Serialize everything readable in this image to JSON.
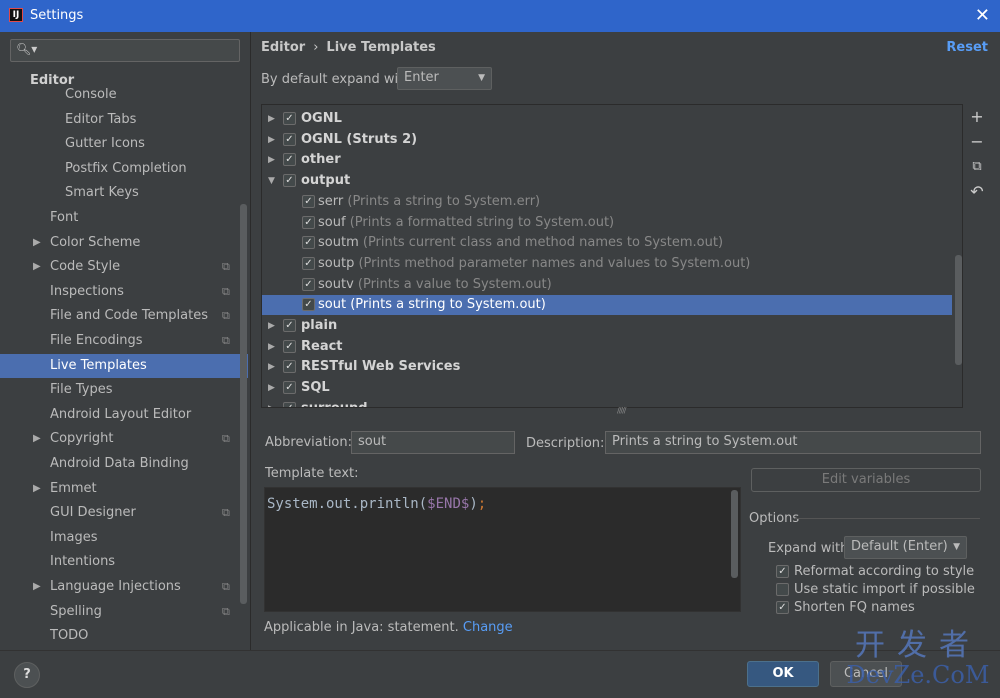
{
  "window": {
    "title": "Settings",
    "app_icon": "intellij-icon"
  },
  "sidebar": {
    "search_placeholder": "",
    "section": "Editor",
    "items": [
      {
        "label": "Console",
        "indent": 2
      },
      {
        "label": "Editor Tabs",
        "indent": 2
      },
      {
        "label": "Gutter Icons",
        "indent": 2
      },
      {
        "label": "Postfix Completion",
        "indent": 2
      },
      {
        "label": "Smart Keys",
        "indent": 2
      },
      {
        "label": "Font",
        "indent": 1
      },
      {
        "label": "Color Scheme",
        "indent": 1,
        "expandable": true
      },
      {
        "label": "Code Style",
        "indent": 1,
        "expandable": true,
        "project": true
      },
      {
        "label": "Inspections",
        "indent": 1,
        "project": true
      },
      {
        "label": "File and Code Templates",
        "indent": 1,
        "project": true
      },
      {
        "label": "File Encodings",
        "indent": 1,
        "project": true
      },
      {
        "label": "Live Templates",
        "indent": 1,
        "selected": true
      },
      {
        "label": "File Types",
        "indent": 1
      },
      {
        "label": "Android Layout Editor",
        "indent": 1
      },
      {
        "label": "Copyright",
        "indent": 1,
        "expandable": true,
        "project": true
      },
      {
        "label": "Android Data Binding",
        "indent": 1
      },
      {
        "label": "Emmet",
        "indent": 1,
        "expandable": true
      },
      {
        "label": "GUI Designer",
        "indent": 1,
        "project": true
      },
      {
        "label": "Images",
        "indent": 1
      },
      {
        "label": "Intentions",
        "indent": 1
      },
      {
        "label": "Language Injections",
        "indent": 1,
        "expandable": true,
        "project": true
      },
      {
        "label": "Spelling",
        "indent": 1,
        "project": true
      },
      {
        "label": "TODO",
        "indent": 1
      }
    ]
  },
  "header": {
    "crumb1": "Editor",
    "separator": "›",
    "crumb2": "Live Templates",
    "reset": "Reset"
  },
  "expand": {
    "label": "By default expand with",
    "value": "Enter"
  },
  "templates": [
    {
      "type": "group",
      "expanded": false,
      "checked": true,
      "name": "OGNL",
      "desc": ""
    },
    {
      "type": "group",
      "expanded": false,
      "checked": true,
      "name": "OGNL (Struts 2)",
      "desc": ""
    },
    {
      "type": "group",
      "expanded": false,
      "checked": true,
      "name": "other",
      "desc": ""
    },
    {
      "type": "group",
      "expanded": true,
      "checked": true,
      "name": "output",
      "desc": ""
    },
    {
      "type": "item",
      "checked": true,
      "name": "serr",
      "desc": "(Prints a string to System.err)"
    },
    {
      "type": "item",
      "checked": true,
      "name": "souf",
      "desc": "(Prints a formatted string to System.out)"
    },
    {
      "type": "item",
      "checked": true,
      "name": "soutm",
      "desc": "(Prints current class and method names to System.out)"
    },
    {
      "type": "item",
      "checked": true,
      "name": "soutp",
      "desc": "(Prints method parameter names and values to System.out)"
    },
    {
      "type": "item",
      "checked": true,
      "name": "soutv",
      "desc": "(Prints a value to System.out)"
    },
    {
      "type": "item",
      "checked": true,
      "name": "sout",
      "desc": "(Prints a string to System.out)",
      "selected": true
    },
    {
      "type": "group",
      "expanded": false,
      "checked": true,
      "name": "plain",
      "desc": ""
    },
    {
      "type": "group",
      "expanded": false,
      "checked": true,
      "name": "React",
      "desc": ""
    },
    {
      "type": "group",
      "expanded": false,
      "checked": true,
      "name": "RESTful Web Services",
      "desc": ""
    },
    {
      "type": "group",
      "expanded": false,
      "checked": true,
      "name": "SQL",
      "desc": ""
    },
    {
      "type": "group",
      "expanded": false,
      "checked": true,
      "name": "surround",
      "desc": ""
    }
  ],
  "toolbar": {
    "add": "+",
    "remove": "−",
    "copy": "⧉",
    "restore": "↶"
  },
  "details": {
    "abbr_label": "Abbreviation:",
    "abbr_value": "sout",
    "desc_label": "Description:",
    "desc_value": "Prints a string to System.out",
    "template_label": "Template text:",
    "code_prefix": "System.out.println(",
    "code_var": "$END$",
    "code_suffix": ")",
    "code_semi": ";",
    "edit_variables": "Edit variables",
    "options_title": "Options",
    "expand_with_label": "Expand with",
    "expand_with_value": "Default (Enter)",
    "opt_reformat": "Reformat according to style",
    "opt_static": "Use static import if possible",
    "opt_shorten": "Shorten FQ names",
    "applicable_text": "Applicable in Java: statement.",
    "applicable_link": "Change"
  },
  "options_state": {
    "reformat": true,
    "static_import": false,
    "shorten": true
  },
  "footer": {
    "help": "?",
    "ok": "OK",
    "cancel": "Cancel"
  },
  "watermark": {
    "cn": "开发者",
    "en": "DevZe.CoM"
  },
  "colors": {
    "accent": "#4b6eaf",
    "link": "#589df6",
    "titlebar": "#2f65ca"
  }
}
